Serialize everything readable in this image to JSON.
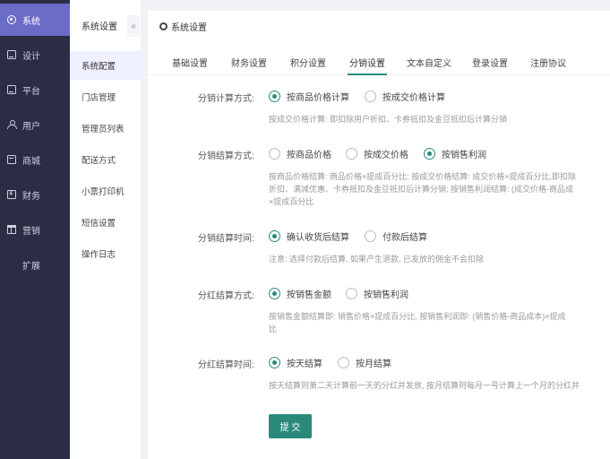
{
  "nav": {
    "items": [
      {
        "label": "系统",
        "icon": "gear-icon"
      },
      {
        "label": "设计",
        "icon": "design-icon"
      },
      {
        "label": "平台",
        "icon": "platform-icon"
      },
      {
        "label": "用户",
        "icon": "user-icon"
      },
      {
        "label": "商城",
        "icon": "mall-icon"
      },
      {
        "label": "财务",
        "icon": "finance-icon"
      },
      {
        "label": "营销",
        "icon": "gift-icon"
      },
      {
        "label": "扩展",
        "icon": "grid-icon"
      }
    ],
    "active_index": 0,
    "active_color": "#6b6cc7"
  },
  "submenu": {
    "title": "系统设置",
    "collapse_glyph": "«",
    "items": [
      "系统配置",
      "门店管理",
      "管理员列表",
      "配送方式",
      "小票打印机",
      "短信设置",
      "操作日志"
    ],
    "active_index": 0
  },
  "page": {
    "title": "系统设置",
    "tabs": [
      "基础设置",
      "财务设置",
      "积分设置",
      "分销设置",
      "文本自定义",
      "登录设置",
      "注册协议"
    ],
    "active_tab": 3,
    "accent_color": "#2a8a7a"
  },
  "form": {
    "calc": {
      "label": "分销计算方式:",
      "options": [
        "按商品价格计算",
        "按成交价格计算"
      ],
      "selected": 0,
      "hint": [
        "按成交价格计算: 即扣除用户折扣、卡券抵扣及金豆抵扣后计算分销"
      ]
    },
    "settle": {
      "label": "分销结算方式:",
      "options": [
        "按商品价格",
        "按成交价格",
        "按销售利润"
      ],
      "selected": 2,
      "hint": [
        "按商品价格结算: 商品价格×提成百分比; 按成交价格结算: 成交价格×提成百分比,即扣除",
        "折扣、满减优惠、卡券抵扣及金豆抵扣后计算分销; 按销售利润结算: (成交价格-商品成",
        "×提成百分比"
      ]
    },
    "settle_time": {
      "label": "分销结算时间:",
      "options": [
        "确认收货后结算",
        "付款后结算"
      ],
      "selected": 0,
      "hint": [
        "注意: 选择付款后结算, 如果产生退款, 已发放的佣金不会扣除"
      ]
    },
    "bonus_calc": {
      "label": "分红结算方式:",
      "options": [
        "按销售金额",
        "按销售利润"
      ],
      "selected": 0,
      "hint": [
        "按销售金额结算即: 销售价格×提成百分比, 按销售利润即: (销售价格-商品成本)×提成",
        "比"
      ]
    },
    "bonus_time": {
      "label": "分红结算时间:",
      "options": [
        "按天结算",
        "按月结算"
      ],
      "selected": 0,
      "hint": [
        "按天结算则第二天计算前一天的分红并发放, 按月结算则每月一号计算上一个月的分红并"
      ]
    },
    "submit_label": "提 交"
  }
}
